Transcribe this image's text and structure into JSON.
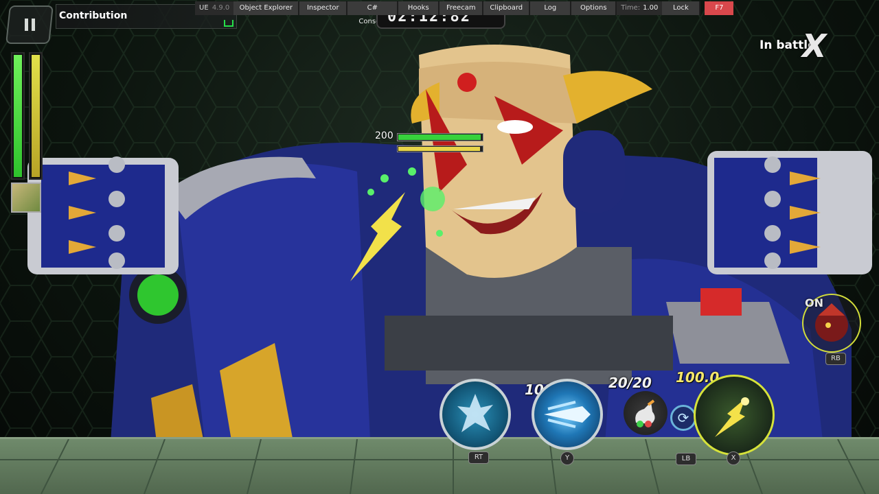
{
  "contribution": {
    "label": "Contribution"
  },
  "toolbar": {
    "ue_label": "UE",
    "ue_version": "4.9.0",
    "buttons": [
      "Object Explorer",
      "Inspector",
      "C# Console",
      "Hooks",
      "Freecam",
      "Clipboard",
      "Log",
      "Options"
    ],
    "time_label": "Time:",
    "time_value": "1.00",
    "lock_label": "Lock",
    "hotkey_label": "F7"
  },
  "timer": {
    "text": "02:12:82"
  },
  "status": {
    "in_battle_label": "In battle",
    "in_battle_mark": "X"
  },
  "enemy": {
    "hp_value": "200"
  },
  "skills": {
    "y_value": "100.0",
    "sub_ammo": "20/20",
    "x_value": "100.0",
    "rt_key": "RT",
    "y_key": "Y",
    "lb_key": "LB",
    "x_key": "X",
    "rb_key": "RB",
    "partner_state": "ON"
  },
  "player": {
    "hp_level": 1.0,
    "energy_level": 1.0
  },
  "colors": {
    "hp": "#3ccf3a",
    "energy": "#d8c33a",
    "f7": "#d9484c",
    "skill_ring": "#d6e23a"
  }
}
